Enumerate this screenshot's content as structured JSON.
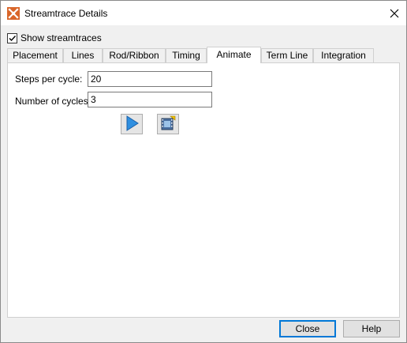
{
  "window": {
    "title": "Streamtrace Details",
    "app_icon": "tecplot-app-icon",
    "close_icon": "close-icon"
  },
  "show_streamtraces": {
    "label": "Show streamtraces",
    "checked": true
  },
  "tabs": [
    {
      "label": "Placement",
      "active": false
    },
    {
      "label": "Lines",
      "active": false
    },
    {
      "label": "Rod/Ribbon",
      "active": false
    },
    {
      "label": "Timing",
      "active": false
    },
    {
      "label": "Animate",
      "active": true
    },
    {
      "label": "Term Line",
      "active": false
    },
    {
      "label": "Integration",
      "active": false
    }
  ],
  "animate": {
    "steps_label": "Steps per cycle:",
    "steps_value": "20",
    "cycles_label": "Number of cycles:",
    "cycles_value": "3",
    "play_icon": "play-icon",
    "export_icon": "export-movie-icon"
  },
  "buttons": {
    "close": "Close",
    "help": "Help"
  },
  "colors": {
    "accent": "#0078d7",
    "play": "#2f8fe0",
    "app_icon": "#d9662a"
  }
}
